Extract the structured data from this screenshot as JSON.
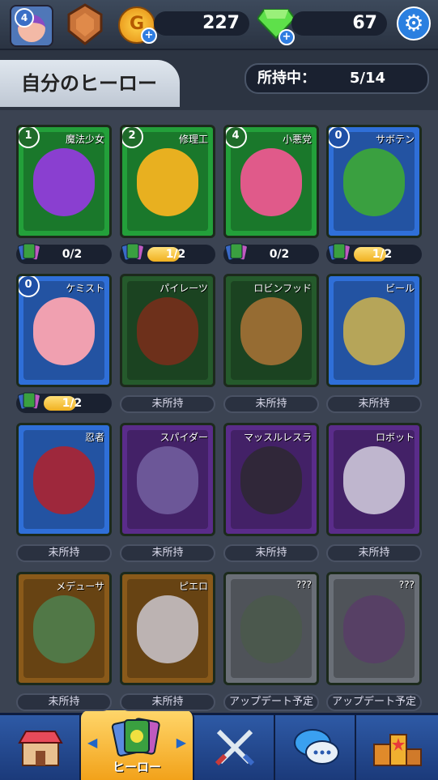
{
  "top": {
    "level": "4",
    "coins": "227",
    "gems": "67"
  },
  "header": {
    "title": "自分のヒーロー",
    "owned_label": "所持中：",
    "owned_value": "5/14"
  },
  "heroes": [
    {
      "name": "魔法少女",
      "badge": "1",
      "progress": "0/2",
      "fill": 0.0,
      "state": "owned",
      "style": "owned-c",
      "face": "#8a3fd0"
    },
    {
      "name": "修理工",
      "badge": "2",
      "progress": "1/2",
      "fill": 0.5,
      "state": "owned",
      "style": "owned-c",
      "face": "#e8b020"
    },
    {
      "name": "小悪党",
      "badge": "4",
      "progress": "0/2",
      "fill": 0.0,
      "state": "owned",
      "style": "owned-c",
      "face": "#e05a8a"
    },
    {
      "name": "サボテン",
      "badge": "0",
      "progress": "1/2",
      "fill": 0.5,
      "state": "owned",
      "style": "blue",
      "face": "#3aa040"
    },
    {
      "name": "ケミスト",
      "badge": "0",
      "progress": "1/2",
      "fill": 0.5,
      "state": "owned",
      "style": "blue",
      "face": "#f0a0b0"
    },
    {
      "name": "パイレーツ",
      "status": "未所持",
      "state": "locked",
      "style": "green-u",
      "face": "#8a2a1a"
    },
    {
      "name": "ロビンフッド",
      "status": "未所持",
      "state": "locked",
      "style": "green-u",
      "face": "#c07a3a"
    },
    {
      "name": "ビール",
      "status": "未所持",
      "state": "locked",
      "style": "blue",
      "face": "#e8c040"
    },
    {
      "name": "忍者",
      "status": "未所持",
      "state": "locked",
      "style": "blue",
      "face": "#c81a1a"
    },
    {
      "name": "スパイダー",
      "status": "未所持",
      "state": "locked",
      "style": "purple",
      "face": "#7a6aa8"
    },
    {
      "name": "マッスルレスラ",
      "status": "未所持",
      "state": "locked",
      "style": "purple",
      "face": "#2a2a2a"
    },
    {
      "name": "ロボット",
      "status": "未所持",
      "state": "locked",
      "style": "purple",
      "face": "#e8e8f0"
    },
    {
      "name": "メデューサ",
      "status": "未所持",
      "state": "locked",
      "style": "orange-u",
      "face": "#4a8a5a"
    },
    {
      "name": "ピエロ",
      "status": "未所持",
      "state": "locked",
      "style": "orange-u",
      "face": "#d8d8e8"
    },
    {
      "name": "???",
      "status": "アップデート予定",
      "state": "upcoming",
      "style": "gray",
      "face": "#4a5a4a"
    },
    {
      "name": "???",
      "status": "アップデート予定",
      "state": "upcoming",
      "style": "gray",
      "face": "#5a3a6a"
    }
  ],
  "nav": {
    "hero_label": "ヒーロー"
  },
  "colors": {
    "accent": "#2f7de0",
    "active_tab": "#f2a21a",
    "progress_fill": "#f0b020"
  }
}
